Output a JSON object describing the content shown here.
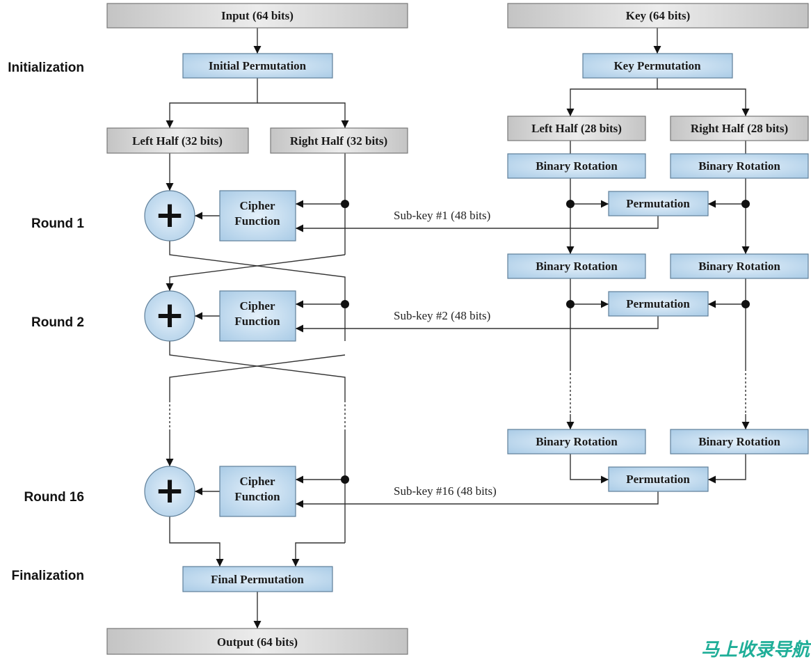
{
  "colors": {
    "gray_box": "#d8d8d8",
    "blue_box": "#bcd8ee",
    "line": "#333333",
    "watermark": "#1fae98"
  },
  "stages": {
    "init": "Initialization",
    "round1": "Round 1",
    "round2": "Round 2",
    "round16": "Round 16",
    "final": "Finalization"
  },
  "data_path": {
    "input": "Input (64 bits)",
    "initial_perm": "Initial Permutation",
    "left_half": "Left Half (32 bits)",
    "right_half": "Right Half (32 bits)",
    "cipher_line1": "Cipher",
    "cipher_line2": "Function",
    "xor_symbol": "+",
    "final_perm": "Final Permutation",
    "output": "Output (64 bits)"
  },
  "key_path": {
    "key": "Key (64 bits)",
    "key_perm": "Key Permutation",
    "left_half": "Left Half (28 bits)",
    "right_half": "Right Half (28 bits)",
    "rotation": "Binary Rotation",
    "permutation": "Permutation"
  },
  "subkeys": [
    "Sub-key #1 (48 bits)",
    "Sub-key #2 (48 bits)",
    "Sub-key #16 (48 bits)"
  ],
  "watermark": "马上收录导航"
}
